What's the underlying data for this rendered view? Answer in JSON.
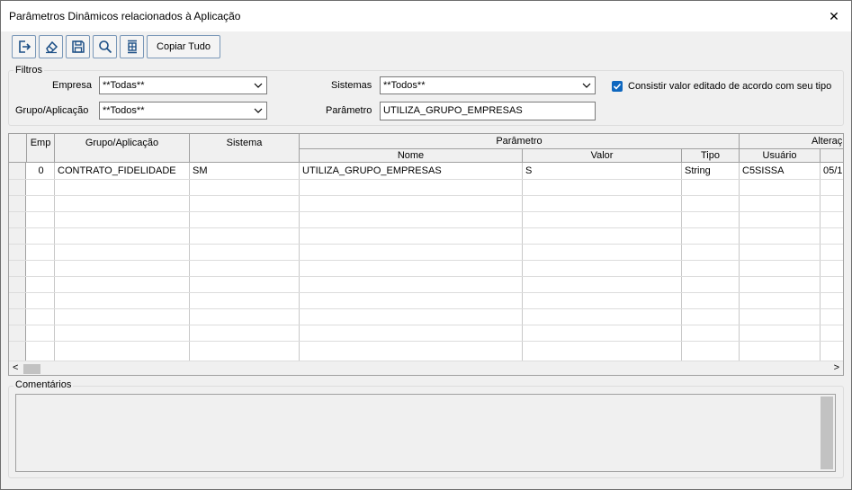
{
  "window": {
    "title": "Parâmetros Dinâmicos relacionados à Aplicação",
    "close_glyph": "✕"
  },
  "toolbar": {
    "buttons": [
      {
        "icon": "exit-icon"
      },
      {
        "icon": "eraser-icon"
      },
      {
        "icon": "save-icon"
      },
      {
        "icon": "search-icon"
      },
      {
        "icon": "columns-icon"
      }
    ],
    "copy_all_label": "Copiar Tudo"
  },
  "filters": {
    "group_label": "Filtros",
    "empresa_label": "Empresa",
    "empresa_value": "**Todas**",
    "grupo_label": "Grupo/Aplicação",
    "grupo_value": "**Todos**",
    "sistemas_label": "Sistemas",
    "sistemas_value": "**Todos**",
    "parametro_label": "Parâmetro",
    "parametro_value": "UTILIZA_GRUPO_EMPRESAS",
    "checkbox_label": "Consistir valor editado de acordo com seu tipo",
    "checkbox_checked": true
  },
  "grid": {
    "headers": {
      "emp": "Emp",
      "grupo": "Grupo/Aplicação",
      "sistema": "Sistema",
      "parametro": "Parâmetro",
      "nome": "Nome",
      "valor": "Valor",
      "tipo": "Tipo",
      "alteracao": "Alteraç",
      "usuario": "Usuário"
    },
    "rows": [
      {
        "emp": "0",
        "grupo": "CONTRATO_FIDELIDADE",
        "sistema": "SM",
        "nome": "UTILIZA_GRUPO_EMPRESAS",
        "valor": "S",
        "tipo": "String",
        "usuario": "C5SISSA",
        "data": "05/1"
      }
    ],
    "scroll_left": "<",
    "scroll_right": ">"
  },
  "comments": {
    "label": "Comentários"
  },
  "colors": {
    "accent": "#0e67bf",
    "button_border": "#7a98b8",
    "icon": "#1c4f86"
  }
}
